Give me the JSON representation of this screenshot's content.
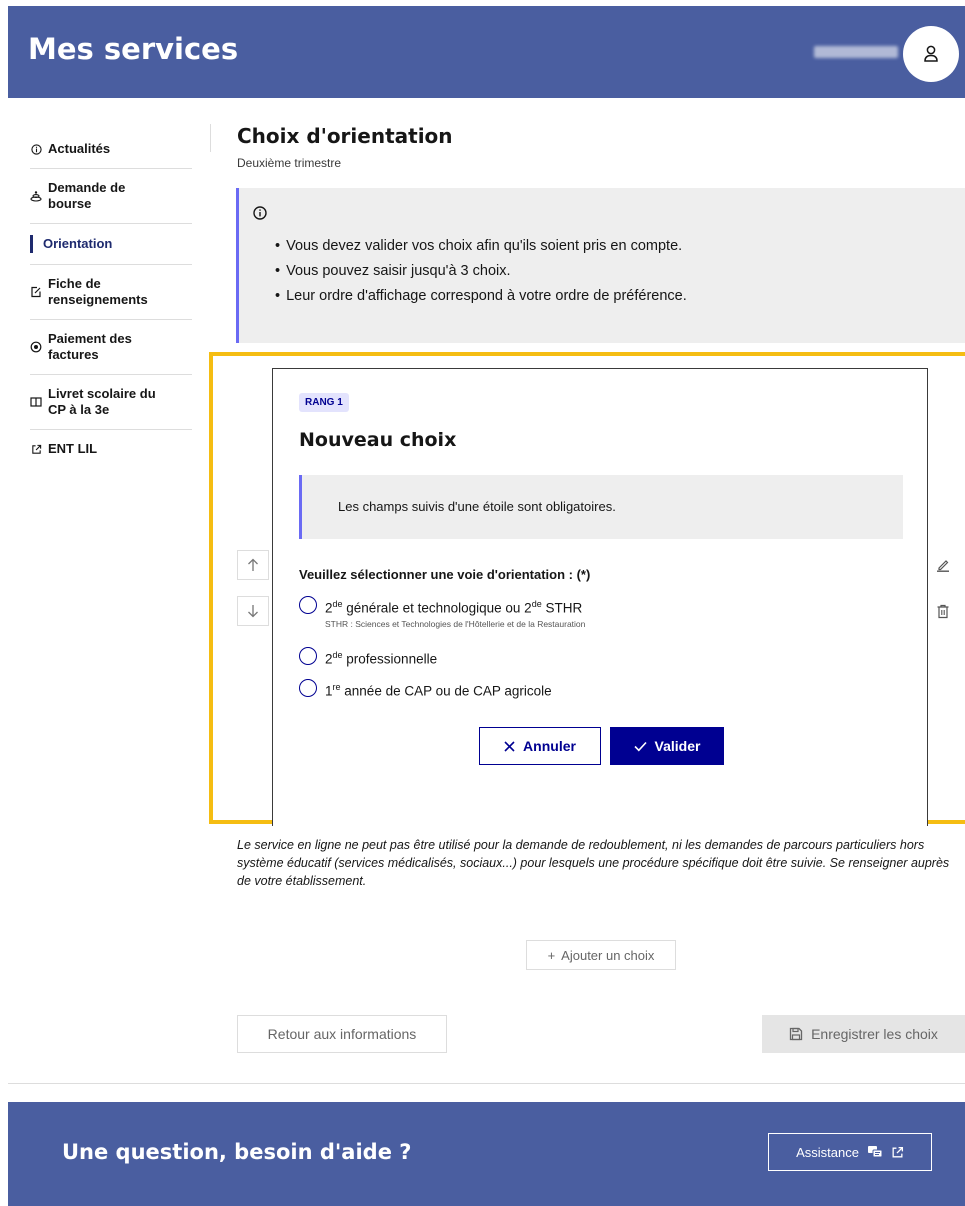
{
  "header": {
    "title": "Mes services"
  },
  "sidebar": {
    "items": [
      {
        "label": "Actualités",
        "icon": "info-circle-icon"
      },
      {
        "label": "Demande de bourse",
        "icon": "coins-icon"
      },
      {
        "label": "Orientation",
        "icon": "active-bar"
      },
      {
        "label": "Fiche de renseignements",
        "icon": "edit-file-icon"
      },
      {
        "label": "Paiement des factures",
        "icon": "wallet-icon"
      },
      {
        "label": "Livret scolaire du CP à la 3e",
        "icon": "book-icon"
      },
      {
        "label": "ENT LIL",
        "icon": "external-link-icon"
      }
    ]
  },
  "page": {
    "title": "Choix d'orientation",
    "subtitle": "Deuxième trimestre"
  },
  "info": {
    "items": [
      "Vous devez valider vos choix afin qu'ils soient pris en compte.",
      "Vous pouvez saisir jusqu'à 3 choix.",
      "Leur ordre d'affichage correspond à votre ordre de préférence."
    ]
  },
  "card": {
    "rank": "RANG 1",
    "title": "Nouveau choix",
    "notice": "Les champs suivis d'une étoile sont obligatoires.",
    "legend": "Veuillez sélectionner une voie d'orientation : (*)",
    "options": [
      {
        "pre": "2",
        "sup": "de",
        "mid": " générale et technologique ou 2",
        "sup2": "de",
        "post": " STHR",
        "hint": "STHR : Sciences et Technologies de l'Hôtellerie et de la Restauration"
      },
      {
        "pre": "2",
        "sup": "de",
        "post": " professionnelle"
      },
      {
        "pre": "1",
        "sup": "re",
        "post": " année de CAP ou de CAP agricole"
      }
    ],
    "cancel_label": "Annuler",
    "validate_label": "Valider"
  },
  "disclaimer": "Le service en ligne ne peut pas être utilisé pour la demande de redoublement, ni les demandes de parcours particuliers hors système éducatif (services médicalisés, sociaux...) pour lesquels une procédure spécifique doit être suivie. Se renseigner auprès de votre établissement.",
  "actions": {
    "add_label": "Ajouter un choix",
    "back_label": "Retour aux informations",
    "save_label": "Enregistrer les choix"
  },
  "footer": {
    "title": "Une question, besoin d'aide ?",
    "assist_label": "Assistance"
  },
  "colors": {
    "header_bg": "#4a5ea0",
    "primary": "#000091",
    "accent_border": "#6a6af4",
    "highlight": "#f5bd12"
  }
}
